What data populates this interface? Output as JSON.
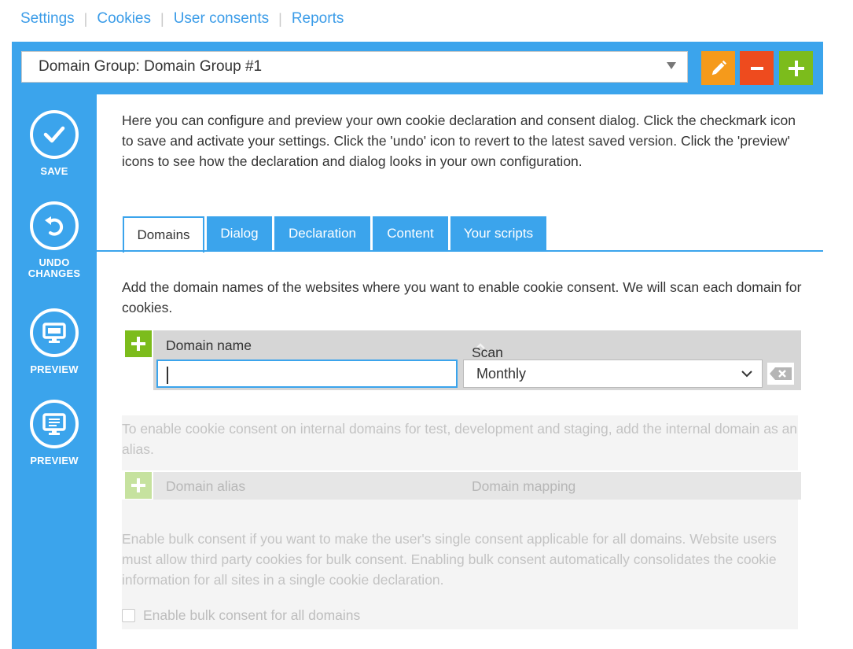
{
  "topnav": {
    "items": [
      "Settings",
      "Cookies",
      "User consents",
      "Reports"
    ]
  },
  "domain_group": {
    "selected": "Domain Group: Domain Group #1"
  },
  "sidebar": {
    "save": "SAVE",
    "undo_line1": "UNDO",
    "undo_line2": "CHANGES",
    "preview1": "PREVIEW",
    "preview2": "PREVIEW"
  },
  "intro_text": "Here you can configure and preview your own cookie declaration and consent dialog. Click the checkmark icon to save and activate your settings. Click the 'undo' icon to revert to the latest saved version. Click the 'preview' icons to see how the declaration and dialog looks in your own configuration.",
  "tabs": [
    "Domains",
    "Dialog",
    "Declaration",
    "Content",
    "Your scripts"
  ],
  "domains": {
    "description": "Add the domain names of the websites where you want to enable cookie consent. We will scan each domain for cookies.",
    "col_domain": "Domain name",
    "col_frequency": "Scan frequency",
    "domain_value": "",
    "frequency_value": "Monthly"
  },
  "alias": {
    "description": "To enable cookie consent on internal domains for test, development and staging, add the internal domain as an alias.",
    "col_alias": "Domain alias",
    "col_mapping": "Domain mapping"
  },
  "bulk": {
    "description": "Enable bulk consent if you want to make the user's single consent applicable for all domains. Website users must allow third party cookies for bulk consent. Enabling bulk consent automatically consolidates the cookie information for all sites in a single cookie declaration.",
    "checkbox_label": "Enable bulk consent for all domains",
    "checked": false
  },
  "colors": {
    "primary": "#3ba4ec",
    "edit": "#f59a1b",
    "remove": "#ee4b1e",
    "add": "#7cbc1c"
  }
}
